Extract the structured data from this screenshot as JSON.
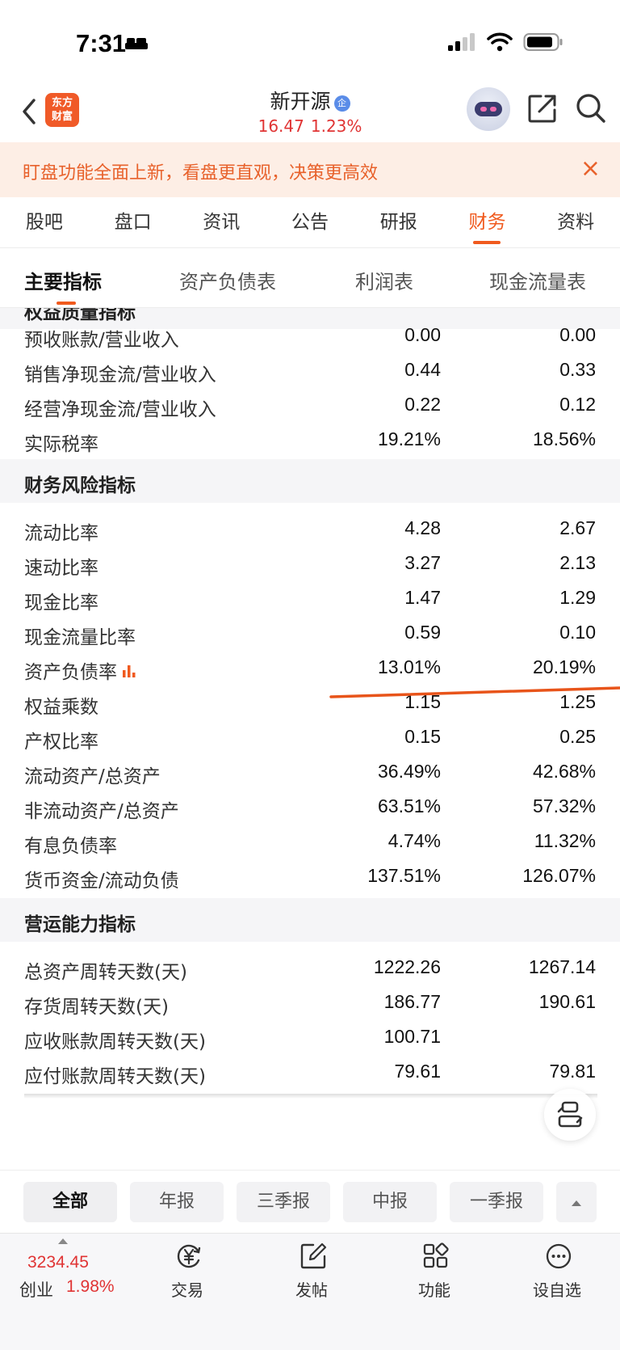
{
  "status_bar": {
    "time": "7:31"
  },
  "header": {
    "logo_line1": "东方",
    "logo_line2": "财富",
    "stock_name": "新开源",
    "stock_badge": "企",
    "price": "16.47",
    "change_pct": "1.23%"
  },
  "banner": {
    "text": "盯盘功能全面上新，看盘更直观，决策更高效",
    "close": "×"
  },
  "tabs": [
    "股吧",
    "盘口",
    "资讯",
    "公告",
    "研报",
    "财务",
    "资料"
  ],
  "active_tab": "财务",
  "subtabs": [
    "主要指标",
    "资产负债表",
    "利润表",
    "现金流量表"
  ],
  "sections": {
    "partial_top_title": "权益质量指标",
    "risk_title": "财务风险指标",
    "operating_title": "营运能力指标"
  },
  "rows_quality": [
    {
      "label": "预收账款/营业收入",
      "v1": "0.00",
      "v2": "0.00"
    },
    {
      "label": "销售净现金流/营业收入",
      "v1": "0.44",
      "v2": "0.33"
    },
    {
      "label": "经营净现金流/营业收入",
      "v1": "0.22",
      "v2": "0.12"
    },
    {
      "label": "实际税率",
      "v1": "19.21%",
      "v2": "18.56%"
    }
  ],
  "rows_risk": [
    {
      "label": "流动比率",
      "v1": "4.28",
      "v2": "2.67"
    },
    {
      "label": "速动比率",
      "v1": "3.27",
      "v2": "2.13"
    },
    {
      "label": "现金比率",
      "v1": "1.47",
      "v2": "1.29"
    },
    {
      "label": "现金流量比率",
      "v1": "0.59",
      "v2": "0.10"
    },
    {
      "label": "资产负债率",
      "v1": "13.01%",
      "v2": "20.19%"
    },
    {
      "label": "权益乘数",
      "v1": "1.15",
      "v2": "1.25"
    },
    {
      "label": "产权比率",
      "v1": "0.15",
      "v2": "0.25"
    },
    {
      "label": "流动资产/总资产",
      "v1": "36.49%",
      "v2": "42.68%"
    },
    {
      "label": "非流动资产/总资产",
      "v1": "63.51%",
      "v2": "57.32%"
    },
    {
      "label": "有息负债率",
      "v1": "4.74%",
      "v2": "11.32%"
    },
    {
      "label": "货币资金/流动负债",
      "v1": "137.51%",
      "v2": "126.07%"
    }
  ],
  "rows_operating": [
    {
      "label": "总资产周转天数(天)",
      "v1": "1222.26",
      "v2": "1267.14"
    },
    {
      "label": "存货周转天数(天)",
      "v1": "186.77",
      "v2": "190.61"
    },
    {
      "label": "应收账款周转天数(天)",
      "v1": "100.71",
      "v2": ""
    },
    {
      "label": "应付账款周转天数(天)",
      "v1": "79.61",
      "v2": "79.81"
    }
  ],
  "filters": [
    "全部",
    "年报",
    "三季报",
    "中报",
    "一季报"
  ],
  "bottom_nav": {
    "index_value": "3234.45",
    "index_name": "创业",
    "index_change": "1.98%",
    "items": [
      "交易",
      "发帖",
      "功能",
      "设自选"
    ]
  },
  "colors": {
    "accent": "#f05a1e",
    "up_red": "#e03434",
    "banner_bg": "#fdeee5"
  }
}
